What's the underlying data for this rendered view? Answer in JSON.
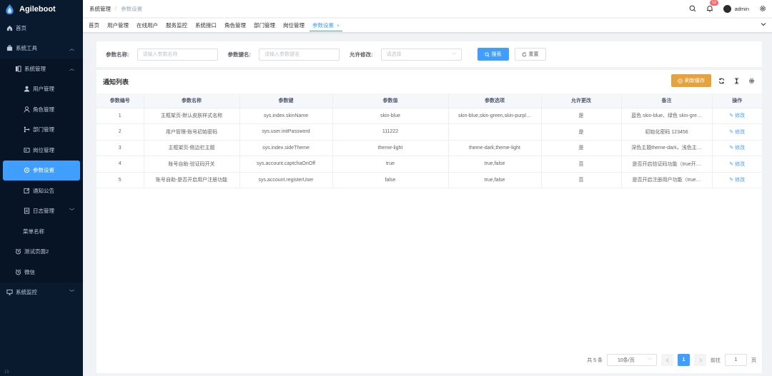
{
  "app": {
    "title": "Agileboot"
  },
  "sidebar": {
    "items": [
      {
        "label": "首页",
        "icon": "home-icon"
      },
      {
        "label": "系统工具",
        "icon": "toolbox-icon"
      },
      {
        "label": "系统管理",
        "icon": "system-icon"
      },
      {
        "label": "用户管理",
        "icon": "user-icon"
      },
      {
        "label": "角色管理",
        "icon": "role-icon"
      },
      {
        "label": "部门管理",
        "icon": "tree-icon"
      },
      {
        "label": "岗位管理",
        "icon": "post-icon"
      },
      {
        "label": "参数设置",
        "icon": "gear-icon"
      },
      {
        "label": "通知公告",
        "icon": "notice-icon"
      },
      {
        "label": "日志管理",
        "icon": "log-icon"
      },
      {
        "label": "菜单名称",
        "icon": ""
      },
      {
        "label": "测试页面2",
        "icon": "alarm-icon"
      },
      {
        "label": "微信",
        "icon": "alarm-icon"
      },
      {
        "label": "系统监控",
        "icon": "monitor-icon"
      }
    ],
    "footer": "15"
  },
  "navbar": {
    "breadcrumb": [
      "系统管理",
      "/",
      "参数设置"
    ],
    "notification_count": "13",
    "username": "admin"
  },
  "tags": [
    {
      "label": "首页"
    },
    {
      "label": "用户管理"
    },
    {
      "label": "在线用户"
    },
    {
      "label": "服务监控"
    },
    {
      "label": "系统接口"
    },
    {
      "label": "角色管理"
    },
    {
      "label": "部门管理"
    },
    {
      "label": "岗位管理"
    },
    {
      "label": "参数设置",
      "close": "×"
    }
  ],
  "search": {
    "config_name_label": "参数名称:",
    "config_name_placeholder": "请输入参数名称",
    "config_key_label": "参数键名:",
    "config_key_placeholder": "请输入参数键名",
    "allow_change_label": "允许修改:",
    "allow_change_placeholder": "请选择",
    "search_button": "搜索",
    "reset_button": "重置"
  },
  "table_card": {
    "title": "通知列表",
    "refresh_cache_button": "刷新缓存"
  },
  "table": {
    "columns": [
      "参数编号",
      "参数名称",
      "参数键",
      "参数值",
      "参数选项",
      "允许更改",
      "备注",
      "操作"
    ],
    "rows": [
      [
        "1",
        "主框架页-默认皮肤样式名称",
        "sys.index.skinName",
        "skin-blue",
        "skin-blue,skin-green,skin-purpl…",
        "是",
        "蓝色 skin-blue、绿色 skin-gre…",
        "修改"
      ],
      [
        "2",
        "用户管理-账号初始密码",
        "sys.user.initPassword",
        "111222",
        "",
        "是",
        "初始化密码 123456",
        "修改"
      ],
      [
        "3",
        "主框架页-侧边栏主题",
        "sys.index.sideTheme",
        "theme-light",
        "theme-dark,theme-light",
        "是",
        "深色主题theme-dark，浅色主…",
        "修改"
      ],
      [
        "4",
        "账号自助-验证码开关",
        "sys.account.captchaOnOff",
        "true",
        "true,false",
        "否",
        "是否开启验证码功能（true开…",
        "修改"
      ],
      [
        "5",
        "账号自助-是否开启用户注册功能",
        "sys.account.registerUser",
        "false",
        "true,false",
        "否",
        "是否开启注册用户功能（true…",
        "修改"
      ]
    ]
  },
  "pagination": {
    "total_text": "共 5 条",
    "page_size": "10条/页",
    "current_page": "1",
    "goto_label": "前往",
    "goto_value": "1",
    "page_unit": "页"
  },
  "colors": {
    "primary": "#409eff",
    "warning": "#e6a23c",
    "sidebar_bg": "#0a1a2e"
  }
}
